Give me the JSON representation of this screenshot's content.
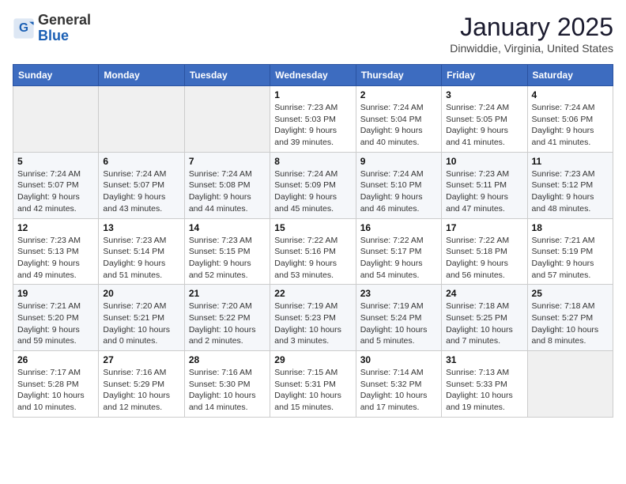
{
  "logo": {
    "general": "General",
    "blue": "Blue"
  },
  "header": {
    "month": "January 2025",
    "location": "Dinwiddie, Virginia, United States"
  },
  "weekdays": [
    "Sunday",
    "Monday",
    "Tuesday",
    "Wednesday",
    "Thursday",
    "Friday",
    "Saturday"
  ],
  "weeks": [
    [
      {
        "day": "",
        "detail": ""
      },
      {
        "day": "",
        "detail": ""
      },
      {
        "day": "",
        "detail": ""
      },
      {
        "day": "1",
        "detail": "Sunrise: 7:23 AM\nSunset: 5:03 PM\nDaylight: 9 hours\nand 39 minutes."
      },
      {
        "day": "2",
        "detail": "Sunrise: 7:24 AM\nSunset: 5:04 PM\nDaylight: 9 hours\nand 40 minutes."
      },
      {
        "day": "3",
        "detail": "Sunrise: 7:24 AM\nSunset: 5:05 PM\nDaylight: 9 hours\nand 41 minutes."
      },
      {
        "day": "4",
        "detail": "Sunrise: 7:24 AM\nSunset: 5:06 PM\nDaylight: 9 hours\nand 41 minutes."
      }
    ],
    [
      {
        "day": "5",
        "detail": "Sunrise: 7:24 AM\nSunset: 5:07 PM\nDaylight: 9 hours\nand 42 minutes."
      },
      {
        "day": "6",
        "detail": "Sunrise: 7:24 AM\nSunset: 5:07 PM\nDaylight: 9 hours\nand 43 minutes."
      },
      {
        "day": "7",
        "detail": "Sunrise: 7:24 AM\nSunset: 5:08 PM\nDaylight: 9 hours\nand 44 minutes."
      },
      {
        "day": "8",
        "detail": "Sunrise: 7:24 AM\nSunset: 5:09 PM\nDaylight: 9 hours\nand 45 minutes."
      },
      {
        "day": "9",
        "detail": "Sunrise: 7:24 AM\nSunset: 5:10 PM\nDaylight: 9 hours\nand 46 minutes."
      },
      {
        "day": "10",
        "detail": "Sunrise: 7:23 AM\nSunset: 5:11 PM\nDaylight: 9 hours\nand 47 minutes."
      },
      {
        "day": "11",
        "detail": "Sunrise: 7:23 AM\nSunset: 5:12 PM\nDaylight: 9 hours\nand 48 minutes."
      }
    ],
    [
      {
        "day": "12",
        "detail": "Sunrise: 7:23 AM\nSunset: 5:13 PM\nDaylight: 9 hours\nand 49 minutes."
      },
      {
        "day": "13",
        "detail": "Sunrise: 7:23 AM\nSunset: 5:14 PM\nDaylight: 9 hours\nand 51 minutes."
      },
      {
        "day": "14",
        "detail": "Sunrise: 7:23 AM\nSunset: 5:15 PM\nDaylight: 9 hours\nand 52 minutes."
      },
      {
        "day": "15",
        "detail": "Sunrise: 7:22 AM\nSunset: 5:16 PM\nDaylight: 9 hours\nand 53 minutes."
      },
      {
        "day": "16",
        "detail": "Sunrise: 7:22 AM\nSunset: 5:17 PM\nDaylight: 9 hours\nand 54 minutes."
      },
      {
        "day": "17",
        "detail": "Sunrise: 7:22 AM\nSunset: 5:18 PM\nDaylight: 9 hours\nand 56 minutes."
      },
      {
        "day": "18",
        "detail": "Sunrise: 7:21 AM\nSunset: 5:19 PM\nDaylight: 9 hours\nand 57 minutes."
      }
    ],
    [
      {
        "day": "19",
        "detail": "Sunrise: 7:21 AM\nSunset: 5:20 PM\nDaylight: 9 hours\nand 59 minutes."
      },
      {
        "day": "20",
        "detail": "Sunrise: 7:20 AM\nSunset: 5:21 PM\nDaylight: 10 hours\nand 0 minutes."
      },
      {
        "day": "21",
        "detail": "Sunrise: 7:20 AM\nSunset: 5:22 PM\nDaylight: 10 hours\nand 2 minutes."
      },
      {
        "day": "22",
        "detail": "Sunrise: 7:19 AM\nSunset: 5:23 PM\nDaylight: 10 hours\nand 3 minutes."
      },
      {
        "day": "23",
        "detail": "Sunrise: 7:19 AM\nSunset: 5:24 PM\nDaylight: 10 hours\nand 5 minutes."
      },
      {
        "day": "24",
        "detail": "Sunrise: 7:18 AM\nSunset: 5:25 PM\nDaylight: 10 hours\nand 7 minutes."
      },
      {
        "day": "25",
        "detail": "Sunrise: 7:18 AM\nSunset: 5:27 PM\nDaylight: 10 hours\nand 8 minutes."
      }
    ],
    [
      {
        "day": "26",
        "detail": "Sunrise: 7:17 AM\nSunset: 5:28 PM\nDaylight: 10 hours\nand 10 minutes."
      },
      {
        "day": "27",
        "detail": "Sunrise: 7:16 AM\nSunset: 5:29 PM\nDaylight: 10 hours\nand 12 minutes."
      },
      {
        "day": "28",
        "detail": "Sunrise: 7:16 AM\nSunset: 5:30 PM\nDaylight: 10 hours\nand 14 minutes."
      },
      {
        "day": "29",
        "detail": "Sunrise: 7:15 AM\nSunset: 5:31 PM\nDaylight: 10 hours\nand 15 minutes."
      },
      {
        "day": "30",
        "detail": "Sunrise: 7:14 AM\nSunset: 5:32 PM\nDaylight: 10 hours\nand 17 minutes."
      },
      {
        "day": "31",
        "detail": "Sunrise: 7:13 AM\nSunset: 5:33 PM\nDaylight: 10 hours\nand 19 minutes."
      },
      {
        "day": "",
        "detail": ""
      }
    ]
  ]
}
